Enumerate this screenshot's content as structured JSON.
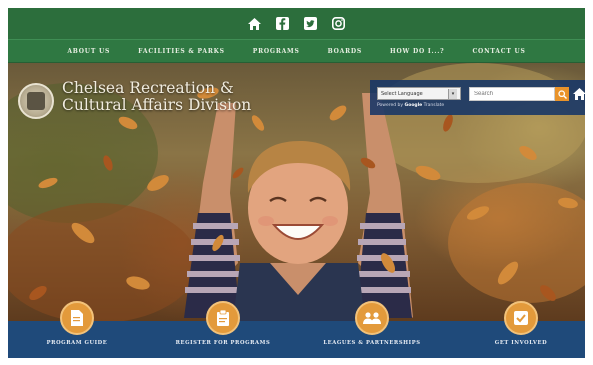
{
  "social_icons": [
    "home-icon",
    "facebook-icon",
    "twitter-icon",
    "instagram-icon"
  ],
  "nav": {
    "items": [
      "ABOUT US",
      "FACILITIES & PARKS",
      "PROGRAMS",
      "BOARDS",
      "HOW DO I...?",
      "CONTACT US"
    ]
  },
  "hero": {
    "title_line1": "Chelsea Recreation &",
    "title_line2": "Cultural Affairs Division"
  },
  "translate": {
    "select_value": "Select Language",
    "powered_prefix": "Powered by",
    "powered_brand": "Google",
    "powered_suffix": "Translate"
  },
  "search": {
    "placeholder": "Search"
  },
  "quick_links": [
    {
      "label": "Program Guide",
      "icon": "document-icon"
    },
    {
      "label": "Register for Programs",
      "icon": "register-icon"
    },
    {
      "label": "Leagues & Partnerships",
      "icon": "group-icon"
    },
    {
      "label": "Get Involved",
      "icon": "check-icon"
    }
  ],
  "colors": {
    "topbar": "#2c6e3c",
    "navbar": "#2f7842",
    "quickbar": "#1f4a7a",
    "accent_orange": "#e39a3b"
  }
}
